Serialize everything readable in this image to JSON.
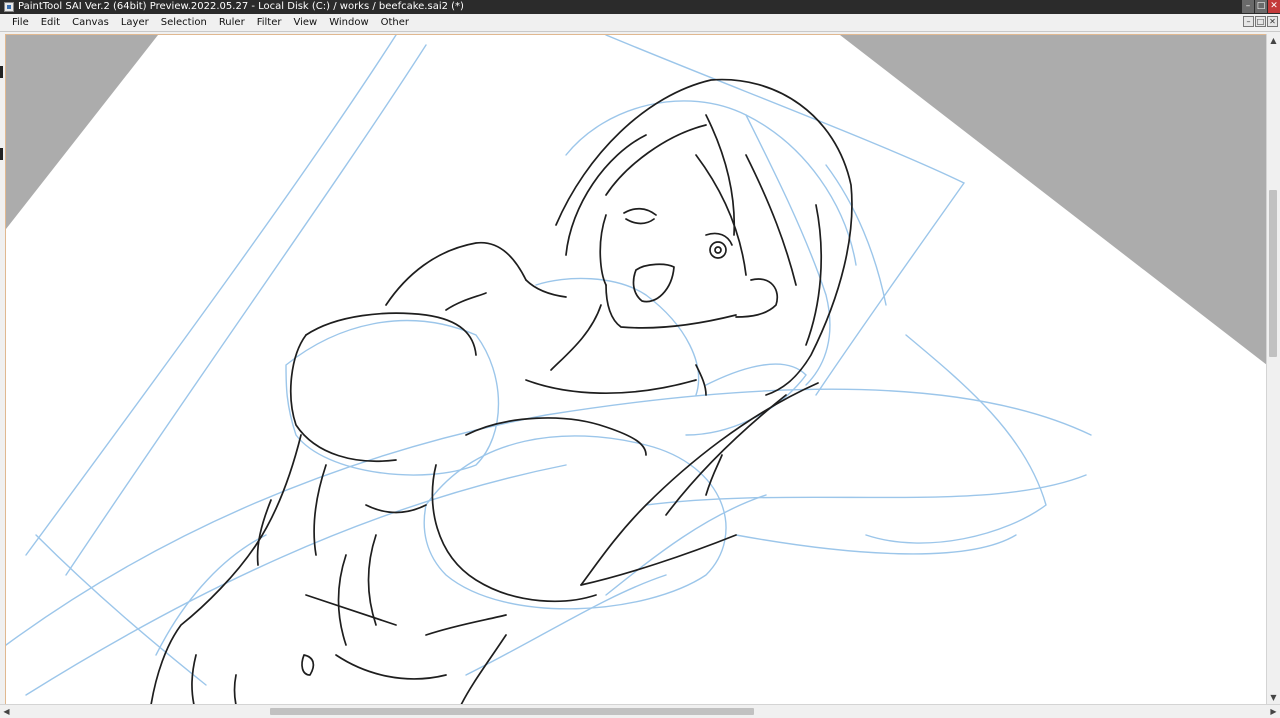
{
  "window": {
    "title": "PaintTool SAI Ver.2 (64bit) Preview.2022.05.27 - Local Disk (C:) / works / beefcake.sai2 (*)",
    "controls": [
      "–",
      "□",
      "✕"
    ]
  },
  "menu": {
    "items": [
      {
        "label": "File"
      },
      {
        "label": "Edit"
      },
      {
        "label": "Canvas"
      },
      {
        "label": "Layer"
      },
      {
        "label": "Selection"
      },
      {
        "label": "Ruler"
      },
      {
        "label": "Filter"
      },
      {
        "label": "View"
      },
      {
        "label": "Window"
      },
      {
        "label": "Other"
      }
    ],
    "doc_controls": [
      "–",
      "□",
      "✕"
    ]
  },
  "scrollbars": {
    "vertical_position": 0.3,
    "vertical_visible_fraction": 0.26,
    "horizontal_position": 0.34,
    "horizontal_visible_fraction": 0.39
  },
  "colors": {
    "titlebar": "#2b2b2b",
    "canvas_background": "#ffffff",
    "outside_canvas": "#acacac",
    "sketch_line": "#9cc6ea",
    "ink_line": "#1e1e1e"
  },
  "icons": {
    "app": "painttool-sai-icon",
    "scroll_up": "▲",
    "scroll_down": "▼",
    "scroll_left": "◀",
    "scroll_right": "▶"
  }
}
